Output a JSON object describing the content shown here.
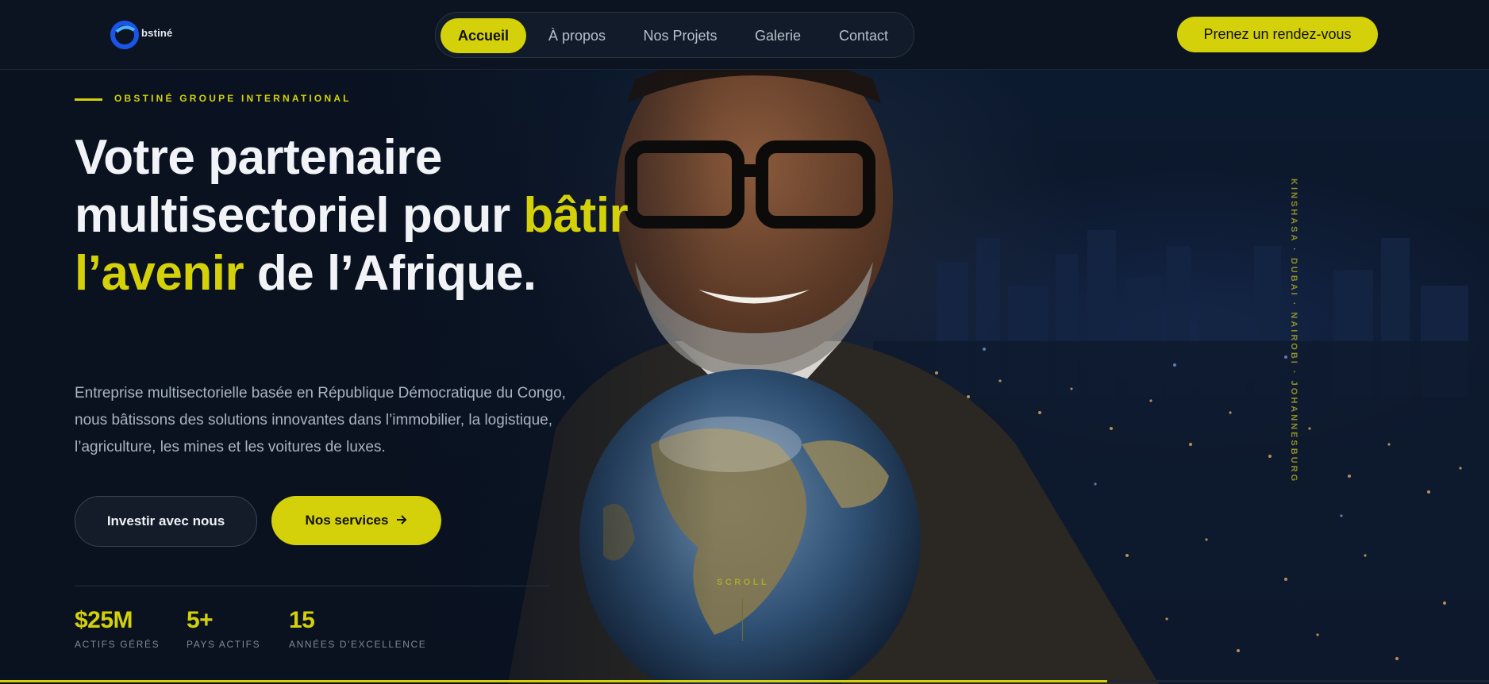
{
  "brand": {
    "logo_text": "bstiné",
    "logo_name": "obstine-logo",
    "accent_color": "#d4d10a",
    "background_color": "#0a1220"
  },
  "nav": {
    "items": [
      {
        "label": "Accueil",
        "active": true
      },
      {
        "label": "À propos",
        "active": false
      },
      {
        "label": "Nos Projets",
        "active": false
      },
      {
        "label": "Galerie",
        "active": false
      },
      {
        "label": "Contact",
        "active": false
      }
    ],
    "cta_label": "Prenez un rendez-vous"
  },
  "hero": {
    "eyebrow": "OBSTINÉ GROUPE INTERNATIONAL",
    "headline": {
      "part1": "Votre partenaire multisectoriel pour",
      "accent": "bâtir l’avenir",
      "part2": "de l’Afrique."
    },
    "lead": "Entreprise multisectorielle basée en République Démocratique du Congo, nous bâtissons des solutions innovantes dans l’immobilier, la logistique, l’agriculture, les mines et les voitures de luxes.",
    "buttons": {
      "invest": "Investir avec nous",
      "services": "Nos services",
      "services_icon": "arrow-right-icon"
    },
    "stats": [
      {
        "value": "$25M",
        "label": "ACTIFS GÉRÉS"
      },
      {
        "value": "5+",
        "label": "PAYS ACTIFS"
      },
      {
        "value": "15",
        "label": "ANNÉES D'EXCELLENCE"
      }
    ],
    "side_cities": "KINSHASA · DUBAI · NAIROBI · JOHANNESBURG",
    "scroll_label": "SCROLL",
    "image": "hero-portrait-with-globe-over-night-city"
  }
}
